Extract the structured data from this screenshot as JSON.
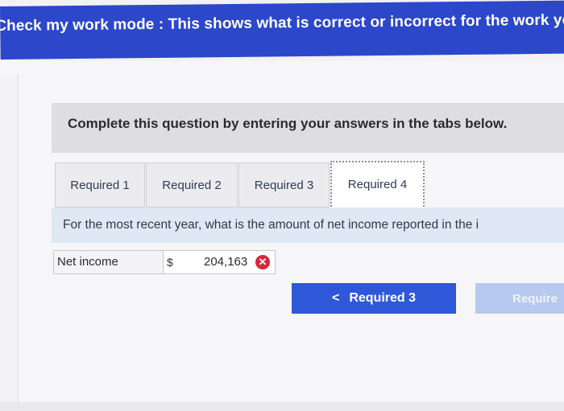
{
  "banner": {
    "text": "Check my work mode : This shows what is correct or incorrect for the work you"
  },
  "instruction": {
    "text": "Complete this question by entering your answers in the tabs below."
  },
  "tabs": [
    {
      "label": "Required 1"
    },
    {
      "label": "Required 2"
    },
    {
      "label": "Required 3"
    },
    {
      "label": "Required 4"
    }
  ],
  "question": {
    "text": "For the most recent year, what is the amount of net income reported in the i"
  },
  "answer": {
    "label": "Net income",
    "currency": "$",
    "value": "204,163",
    "status_icon": "incorrect-x-icon",
    "status_glyph": "✕"
  },
  "navigation": {
    "prev_chevron": "<",
    "prev_label": "Required 3",
    "next_label": "Require"
  },
  "colors": {
    "banner": "#2c47c9",
    "primary_button": "#2f58d8",
    "disabled_button": "#b8c9ef",
    "error": "#d9253b",
    "question_band": "#dfe8f4"
  }
}
